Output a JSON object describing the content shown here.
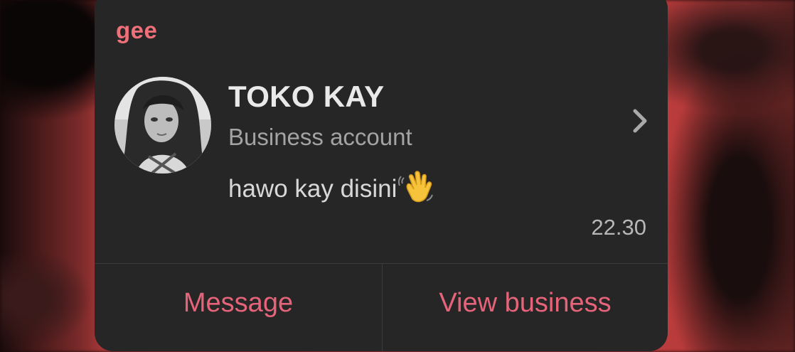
{
  "card": {
    "group_name": "gee",
    "contact": {
      "name": "TOKO KAY",
      "account_type": "Business account",
      "last_message": "hawo kay disini",
      "last_message_emoji": "waving-hand",
      "time": "22.30"
    },
    "actions": {
      "message_label": "Message",
      "view_business_label": "View business"
    }
  },
  "colors": {
    "accent": "#e6647a",
    "group_name": "#f0707a",
    "card_bg": "#262626",
    "wallpaper": "#c84040"
  }
}
